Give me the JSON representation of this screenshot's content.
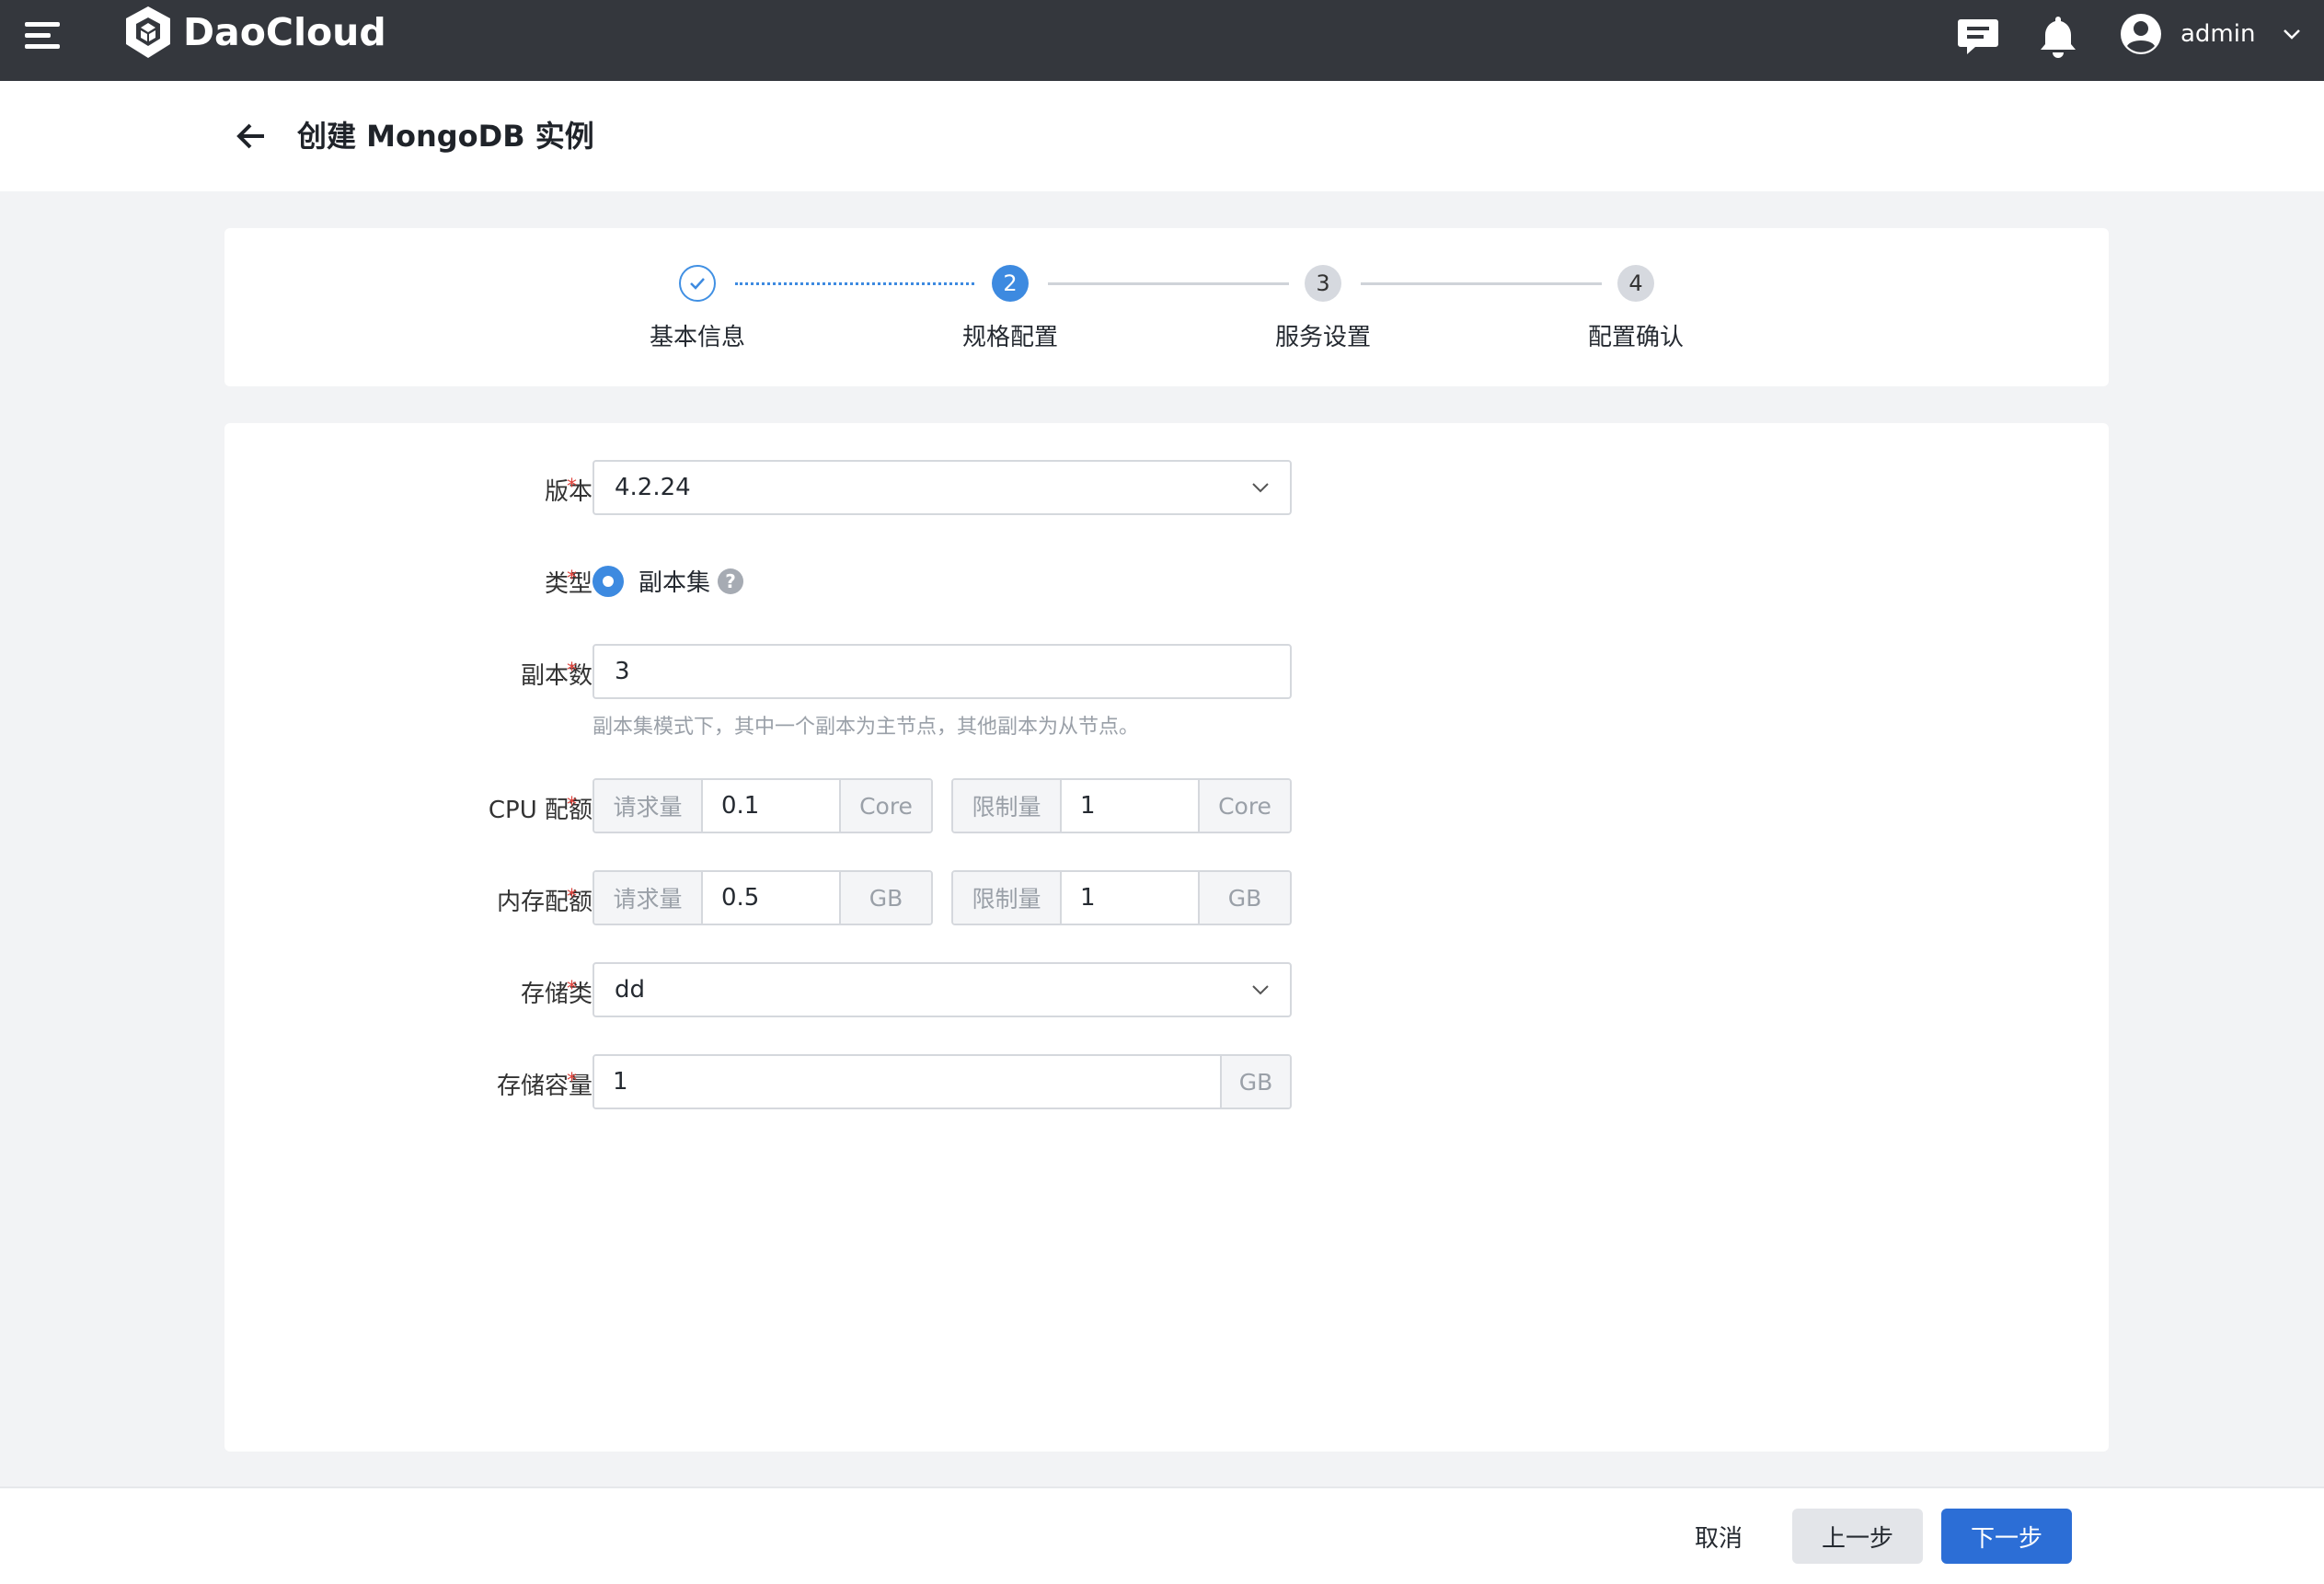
{
  "app": {
    "brand": "DaoCloud"
  },
  "topbar": {
    "icons": [
      "menu-icon",
      "message-icon",
      "bell-icon",
      "user-avatar-icon",
      "chevron-down-icon"
    ],
    "user_name": "admin"
  },
  "header": {
    "title": "创建 MongoDB 实例"
  },
  "steps": [
    {
      "index": "1",
      "label": "基本信息",
      "state": "done"
    },
    {
      "index": "2",
      "label": "规格配置",
      "state": "active"
    },
    {
      "index": "3",
      "label": "服务设置",
      "state": "wait"
    },
    {
      "index": "4",
      "label": "配置确认",
      "state": "wait"
    }
  ],
  "form": {
    "required_mark": "*",
    "version": {
      "label": "版本",
      "value": "4.2.24"
    },
    "type": {
      "label": "类型",
      "option": "副本集",
      "help": "?"
    },
    "replicas": {
      "label": "副本数",
      "value": "3",
      "hint": "副本集模式下，其中一个副本为主节点，其他副本为从节点。"
    },
    "cpu": {
      "label": "CPU 配额",
      "request_label": "请求量",
      "request_value": "0.1",
      "request_unit": "Core",
      "limit_label": "限制量",
      "limit_value": "1",
      "limit_unit": "Core"
    },
    "memory": {
      "label": "内存配额",
      "request_label": "请求量",
      "request_value": "0.5",
      "request_unit": "GB",
      "limit_label": "限制量",
      "limit_value": "1",
      "limit_unit": "GB"
    },
    "storage_class": {
      "label": "存储类",
      "value": "dd"
    },
    "storage_capacity": {
      "label": "存储容量",
      "value": "1",
      "unit": "GB"
    }
  },
  "footer": {
    "cancel": "取消",
    "prev": "上一步",
    "next": "下一步"
  },
  "colors": {
    "topbar": "#34373d",
    "primary": "#2c6ed6",
    "step_active": "#3d8ae0",
    "required": "#e0433c"
  }
}
